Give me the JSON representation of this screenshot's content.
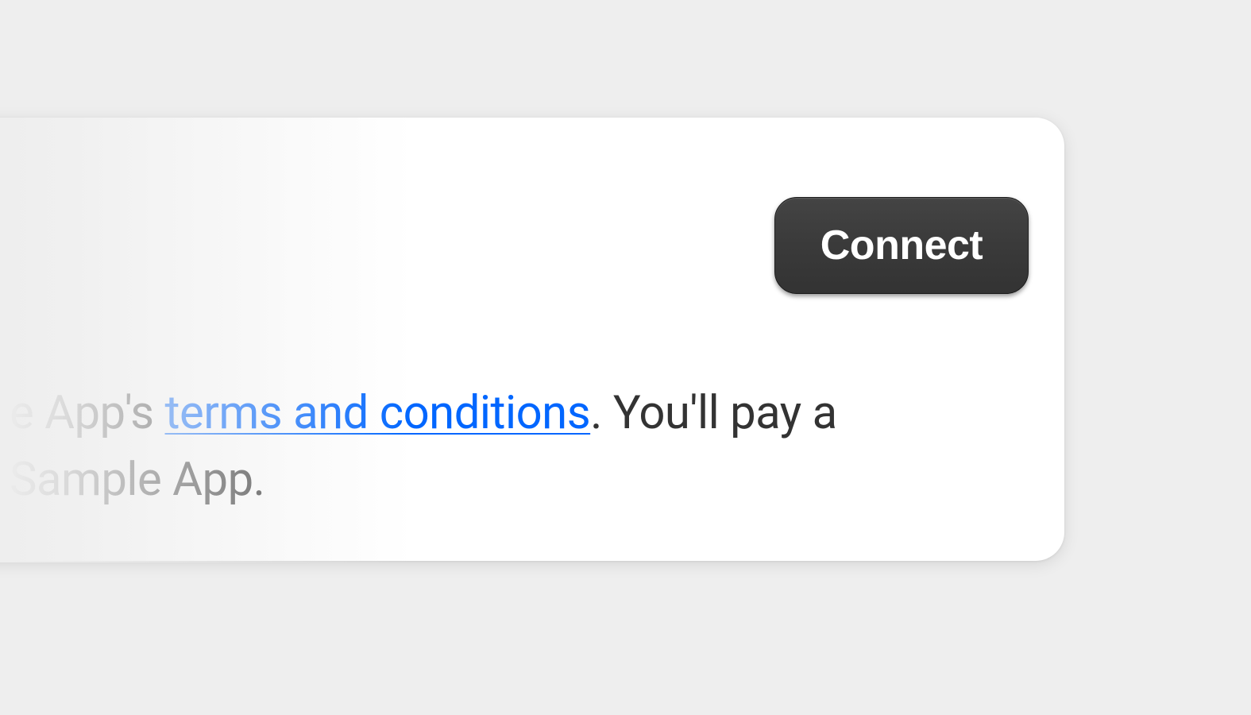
{
  "button": {
    "connect_label": "Connect"
  },
  "disclosure": {
    "text_before_link": "e App's ",
    "link_text": "terms and conditions",
    "text_after_link_line1": ". You'll pay a",
    "text_line2": "Sample App."
  }
}
